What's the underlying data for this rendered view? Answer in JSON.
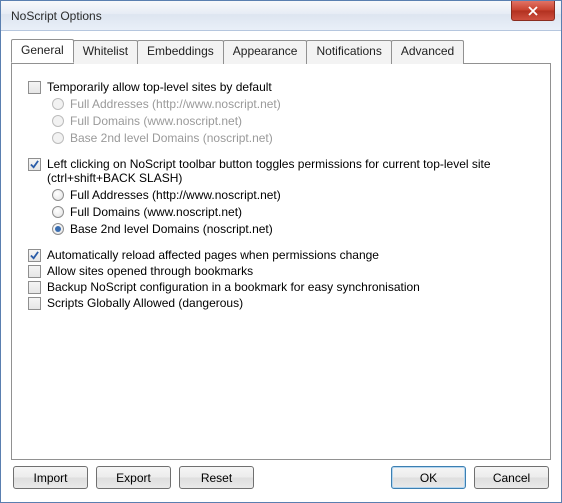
{
  "window": {
    "title": "NoScript Options"
  },
  "tabs": [
    {
      "label": "General",
      "active": true
    },
    {
      "label": "Whitelist",
      "active": false
    },
    {
      "label": "Embeddings",
      "active": false
    },
    {
      "label": "Appearance",
      "active": false
    },
    {
      "label": "Notifications",
      "active": false
    },
    {
      "label": "Advanced",
      "active": false
    }
  ],
  "general": {
    "tempAllow": {
      "checked": false,
      "label": "Temporarily allow top-level sites by default",
      "options": [
        {
          "label": "Full Addresses (http://www.noscript.net)",
          "selected": false
        },
        {
          "label": "Full Domains (www.noscript.net)",
          "selected": false
        },
        {
          "label": "Base 2nd level Domains (noscript.net)",
          "selected": false
        }
      ]
    },
    "leftClick": {
      "checked": true,
      "label": "Left clicking on NoScript toolbar button toggles permissions for current top-level site (ctrl+shift+BACK SLASH)",
      "options": [
        {
          "label": "Full Addresses (http://www.noscript.net)",
          "selected": false
        },
        {
          "label": "Full Domains (www.noscript.net)",
          "selected": false
        },
        {
          "label": "Base 2nd level Domains (noscript.net)",
          "selected": true
        }
      ]
    },
    "extras": [
      {
        "label": "Automatically reload affected pages when permissions change",
        "checked": true
      },
      {
        "label": "Allow sites opened through bookmarks",
        "checked": false
      },
      {
        "label": "Backup NoScript configuration in a bookmark for easy synchronisation",
        "checked": false
      },
      {
        "label": "Scripts Globally Allowed (dangerous)",
        "checked": false
      }
    ]
  },
  "buttons": {
    "import": "Import",
    "export": "Export",
    "reset": "Reset",
    "ok": "OK",
    "cancel": "Cancel"
  }
}
